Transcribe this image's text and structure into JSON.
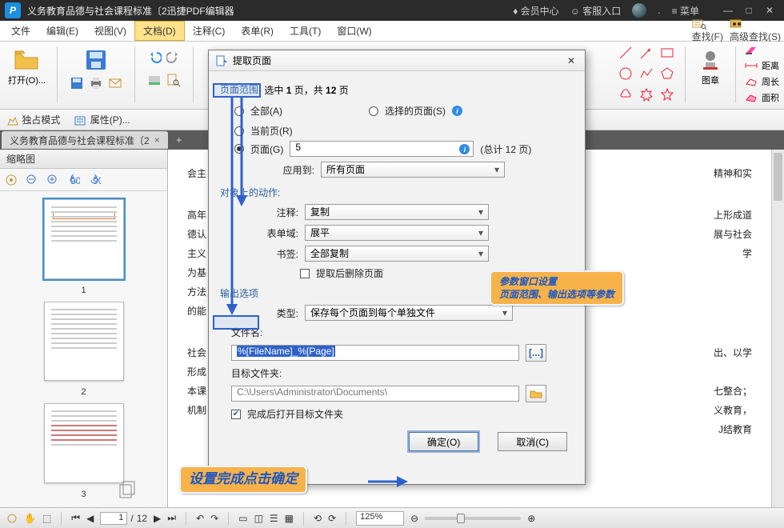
{
  "titlebar": {
    "title": "义务教育品德与社会课程标准〔2迅捷PDF编辑器",
    "member": "会员中心",
    "service": "客服入口",
    "dot": ".",
    "menu": "菜单"
  },
  "menubar": {
    "items": [
      "文件",
      "编辑(E)",
      "视图(V)",
      "文档(D)",
      "注释(C)",
      "表单(R)",
      "工具(T)",
      "窗口(W)"
    ],
    "activeIndex": 3,
    "search": "查找(F)",
    "advsearch": "高级查找(S)"
  },
  "toolbar": {
    "open": "打开(O)...",
    "stamp": "图章",
    "rightcol": {
      "distance": "距离",
      "perimeter": "周长",
      "area": "面积"
    }
  },
  "secondbar": {
    "exclusive": "独占模式",
    "props": "属性(P)..."
  },
  "tab": {
    "name": "义务教育品德与社会课程标准〔2"
  },
  "side": {
    "head": "缩略图",
    "n1": "1",
    "n2": "2",
    "n3": "3"
  },
  "page_content": {
    "l1": "会主",
    "l2": "高年",
    "l3": "德认",
    "l4": "主义",
    "l5": "为基",
    "l6": "方法，",
    "l7": "的能",
    "l8": "社会",
    "l9": "形成",
    "l10": "本课",
    "l11": "机制",
    "r1": "精神和实",
    "r2": "上形成道",
    "r3": "展与社会",
    "r4": "学",
    "r5": "出、以学",
    "r6": "七整合；",
    "r7": "义教育，",
    "r8": "J结教育"
  },
  "dialog": {
    "title": "提取页面",
    "range_label": "页面范围:",
    "range_text_a": "选中 ",
    "range_text_b": " 页，共 ",
    "range_text_c": " 页",
    "sel": "1",
    "total": "12",
    "all": "全部(A)",
    "selected": "选择的页面(S)",
    "current": "当前页(R)",
    "pages": "页面(G)",
    "page_val": "5",
    "total2": "(总计 12 页)",
    "apply": "应用到:",
    "apply_val": "所有页面",
    "actions": "对象上的动作:",
    "comment": "注释:",
    "comment_val": "复制",
    "form": "表单域:",
    "form_val": "展平",
    "bookmark": "书签:",
    "bookmark_val": "全部复制",
    "delafter": "提取后删除页面",
    "output": "输出选项",
    "type": "类型:",
    "type_val": "保存每个页面到每个单独文件",
    "filename": "文件名:",
    "filename_val": "%[FileName]_%[Page]",
    "patt": "[...]",
    "destfolder": "目标文件夹:",
    "dest_val": "C:\\Users\\Administrator\\Documents\\",
    "openafter": "完成后打开目标文件夹",
    "ok": "确定(O)",
    "cancel": "取消(C)"
  },
  "status": {
    "page": "1",
    "pages": "12",
    "zoom": "125%"
  },
  "annot": {
    "a1a": "参数窗口设置",
    "a1b": "页面范围、输出选项等参数",
    "a2": "设置完成点击确定"
  }
}
